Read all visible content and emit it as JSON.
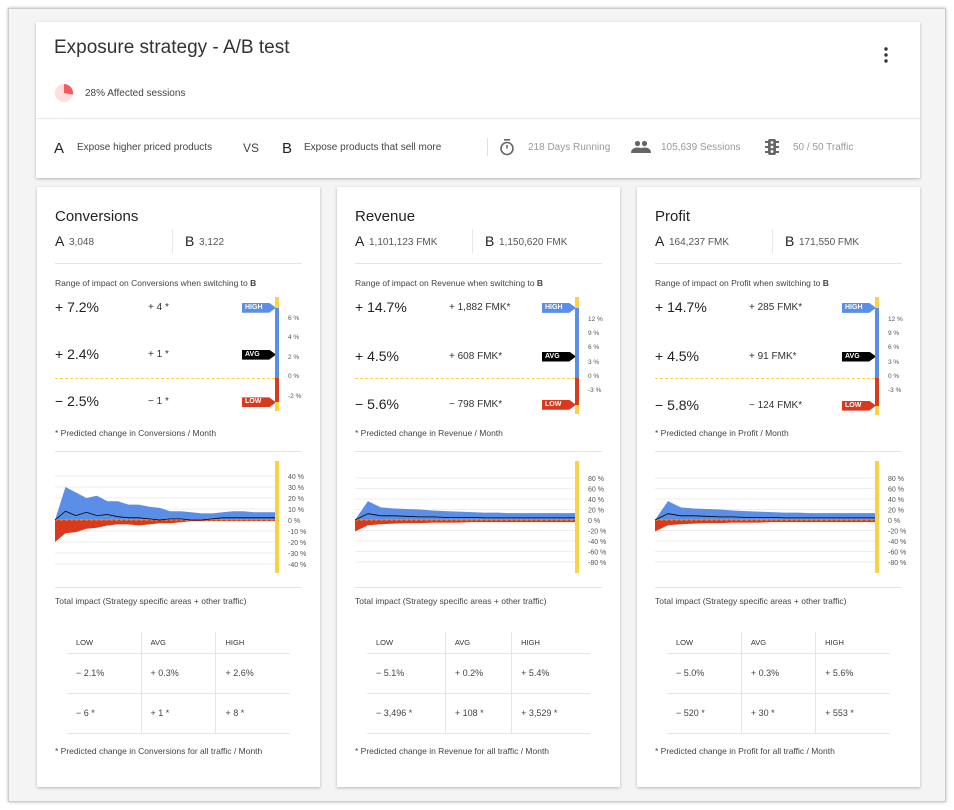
{
  "header": {
    "title": "Exposure strategy - A/B test",
    "affected": "28% Affected sessions",
    "affected_fraction": 0.28,
    "a_letter": "A",
    "a_text": "Expose higher priced products",
    "vs": "VS",
    "b_letter": "B",
    "b_text": "Expose products that sell more",
    "days": "218 Days Running",
    "sessions": "105,639 Sessions",
    "traffic": "50 / 50 Traffic",
    "icons": [
      "stopwatch-icon",
      "people-icon",
      "traffic-light-icon",
      "more-vert-icon"
    ]
  },
  "colors": {
    "high": "#5b8ee6",
    "avg": "#000000",
    "low": "#d93a1e",
    "accent": "#f9d247",
    "pie": "#f25c5c"
  },
  "cards": [
    {
      "title": "Conversions",
      "a_label": "A",
      "a_value": "3,048",
      "b_label": "B",
      "b_value": "3,122",
      "range_label": "Range of impact on Conversions when switching to ",
      "range_b": "B",
      "high_pct": "+ 7.2%",
      "high_abs": "+ 4 *",
      "avg_pct": "+ 2.4%",
      "avg_abs": "+ 1 *",
      "low_pct": "− 2.5%",
      "low_abs": "− 1 *",
      "high": 7.2,
      "avg": 2.4,
      "low": -2.5,
      "flags": {
        "high": "HIGH",
        "avg": "AVG",
        "low": "LOW"
      },
      "bar_ticks": [
        "6 %",
        "4 %",
        "2 %",
        "0 %",
        "-2 %"
      ],
      "bar_tick_values": [
        6,
        4,
        2,
        0,
        -2
      ],
      "footnote": "* Predicted change in Conversions / Month",
      "total_label": "Total impact (Strategy specific areas + other traffic)",
      "table": {
        "headers": [
          "LOW",
          "AVG",
          "HIGH"
        ],
        "rows": [
          [
            "− 2.1%",
            "+ 0.3%",
            "+ 2.6%"
          ],
          [
            "− 6 *",
            "+ 1 *",
            "+ 8 *"
          ]
        ]
      },
      "footnote2": "* Predicted change in Conversions for all traffic / Month"
    },
    {
      "title": "Revenue",
      "a_label": "A",
      "a_value": "1,101,123 FMK",
      "b_label": "B",
      "b_value": "1,150,620 FMK",
      "range_label": "Range of impact on Revenue when switching to ",
      "range_b": "B",
      "high_pct": "+ 14.7%",
      "high_abs": "+ 1,882 FMK*",
      "avg_pct": "+ 4.5%",
      "avg_abs": "+ 608 FMK*",
      "low_pct": "− 5.6%",
      "low_abs": "− 798 FMK*",
      "high": 14.7,
      "avg": 4.5,
      "low": -5.6,
      "flags": {
        "high": "HIGH",
        "avg": "AVG",
        "low": "LOW"
      },
      "bar_ticks": [
        "12 %",
        "9 %",
        "6 %",
        "3 %",
        "0 %",
        "-3 %"
      ],
      "bar_tick_values": [
        12,
        9,
        6,
        3,
        0,
        -3
      ],
      "footnote": "* Predicted change in Revenue / Month",
      "total_label": "Total impact (Strategy specific areas + other traffic)",
      "table": {
        "headers": [
          "LOW",
          "AVG",
          "HIGH"
        ],
        "rows": [
          [
            "− 5.1%",
            "+ 0.2%",
            "+ 5.4%"
          ],
          [
            "− 3,496 *",
            "+ 108 *",
            "+ 3,529 *"
          ]
        ]
      },
      "footnote2": "* Predicted change in Revenue for all traffic / Month"
    },
    {
      "title": "Profit",
      "a_label": "A",
      "a_value": "164,237 FMK",
      "b_label": "B",
      "b_value": "171,550 FMK",
      "range_label": "Range of impact on Profit when switching to ",
      "range_b": "B",
      "high_pct": "+ 14.7%",
      "high_abs": "+ 285 FMK*",
      "avg_pct": "+ 4.5%",
      "avg_abs": "+ 91 FMK*",
      "low_pct": "− 5.8%",
      "low_abs": "− 124 FMK*",
      "high": 14.7,
      "avg": 4.5,
      "low": -5.8,
      "flags": {
        "high": "HIGH",
        "avg": "AVG",
        "low": "LOW"
      },
      "bar_ticks": [
        "12 %",
        "9 %",
        "6 %",
        "3 %",
        "0 %",
        "-3 %"
      ],
      "bar_tick_values": [
        12,
        9,
        6,
        3,
        0,
        -3
      ],
      "footnote": "* Predicted change in Profit / Month",
      "total_label": "Total impact (Strategy specific areas + other traffic)",
      "table": {
        "headers": [
          "LOW",
          "AVG",
          "HIGH"
        ],
        "rows": [
          [
            "− 5.0%",
            "+ 0.3%",
            "+ 5.6%"
          ],
          [
            "− 520 *",
            "+ 30 *",
            "+ 553 *"
          ]
        ]
      },
      "footnote2": "* Predicted change in Profit for all traffic / Month"
    }
  ],
  "chart_data": [
    {
      "type": "area",
      "yticks": [
        "40 %",
        "30 %",
        "20 %",
        "10 %",
        "0 %",
        "-10 %",
        "-20 %",
        "-30 %",
        "-40 %"
      ],
      "ylim": [
        -40,
        40
      ],
      "upper": [
        0,
        30,
        25,
        20,
        22,
        17,
        17,
        14,
        14,
        12,
        11,
        8,
        8,
        7,
        6,
        6,
        7,
        8,
        8,
        7,
        7,
        7
      ],
      "lower": [
        -20,
        -12,
        -11,
        -8,
        -7,
        -5,
        -4,
        -4,
        -5,
        -4,
        -3,
        -3,
        -2,
        -1,
        -1,
        -1,
        -1,
        -1,
        -1,
        -1,
        -1,
        -1
      ],
      "avg": [
        0,
        8,
        4,
        7,
        4,
        5,
        3,
        2,
        2,
        1,
        0,
        1,
        1,
        0,
        0,
        1,
        2,
        2,
        2,
        2,
        2,
        2
      ]
    },
    {
      "type": "area",
      "yticks": [
        "80 %",
        "60 %",
        "40 %",
        "20 %",
        "0 %",
        "-20 %",
        "-40 %",
        "-60 %",
        "-80 %"
      ],
      "ylim": [
        -80,
        80
      ],
      "upper": [
        0,
        36,
        24,
        22,
        21,
        20,
        18,
        17,
        16,
        15,
        14,
        14,
        13,
        13,
        13,
        13,
        13,
        13
      ],
      "lower": [
        -22,
        -10,
        -8,
        -7,
        -6,
        -6,
        -5,
        -5,
        -5,
        -4,
        -4,
        -4,
        -4,
        -4,
        -4,
        -4,
        -4,
        -4
      ],
      "avg": [
        0,
        12,
        8,
        8,
        7,
        6,
        6,
        5,
        5,
        5,
        4,
        4,
        4,
        4,
        4,
        4,
        4,
        4
      ]
    },
    {
      "type": "area",
      "yticks": [
        "80 %",
        "60 %",
        "40 %",
        "20 %",
        "0 %",
        "-20 %",
        "-40 %",
        "-60 %",
        "-80 %"
      ],
      "ylim": [
        -80,
        80
      ],
      "upper": [
        0,
        36,
        24,
        22,
        21,
        20,
        18,
        17,
        16,
        15,
        14,
        14,
        13,
        13,
        13,
        13,
        13,
        13
      ],
      "lower": [
        -22,
        -10,
        -8,
        -7,
        -6,
        -6,
        -5,
        -5,
        -5,
        -4,
        -4,
        -4,
        -4,
        -4,
        -4,
        -4,
        -4,
        -4
      ],
      "avg": [
        0,
        12,
        8,
        8,
        7,
        6,
        6,
        5,
        5,
        5,
        4,
        4,
        4,
        4,
        4,
        4,
        4,
        4
      ]
    }
  ]
}
